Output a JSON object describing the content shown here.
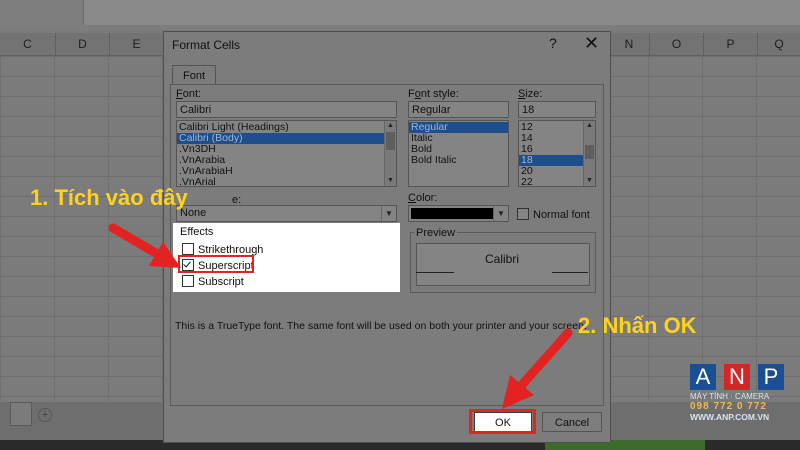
{
  "sheet": {
    "columns": [
      "C",
      "D",
      "E",
      "N",
      "O",
      "P",
      "Q"
    ]
  },
  "dialog": {
    "title": "Format Cells",
    "help": "?",
    "close": "✕",
    "tab_font": "Font",
    "font_label": "Font:",
    "font_value": "Calibri",
    "font_list": [
      "Calibri Light (Headings)",
      "Calibri (Body)",
      ".Vn3DH",
      ".VnArabia",
      ".VnArabiaH",
      ".VnArial"
    ],
    "font_list_selected": 1,
    "style_label": "Font style:",
    "style_value": "Regular",
    "style_list": [
      "Regular",
      "Italic",
      "Bold",
      "Bold Italic"
    ],
    "style_list_selected": 0,
    "size_label": "Size:",
    "size_value": "18",
    "size_list": [
      "12",
      "14",
      "16",
      "18",
      "20",
      "22"
    ],
    "size_list_selected": 3,
    "underline_label_tail": "e:",
    "underline_value": "None",
    "color_label": "Color:",
    "color_swatch": "#000000",
    "normal_font": "Normal font",
    "effects_label": "Effects",
    "strikethrough": "Strikethrough",
    "superscript": "Superscript",
    "subscript": "Subscript",
    "superscript_checked": true,
    "preview_label": "Preview",
    "preview_text": "Calibri",
    "note": "This is a TrueType font.  The same font will be used on both your printer and your screen.",
    "ok": "OK",
    "cancel": "Cancel"
  },
  "annotations": {
    "step1": "1. Tích vào đây",
    "step2": "2. Nhấn OK",
    "color": "#ffd21f",
    "arrow_color": "#e32222"
  },
  "logo": {
    "letters": [
      "A",
      "N",
      "P"
    ],
    "letter_colors": [
      "#1b4f93",
      "#d22727",
      "#1b4f93"
    ],
    "tagline": "MÁY TÍNH · CAMERA",
    "phone": "098 772 0 772",
    "website": "WWW.ANP.COM.VN"
  }
}
